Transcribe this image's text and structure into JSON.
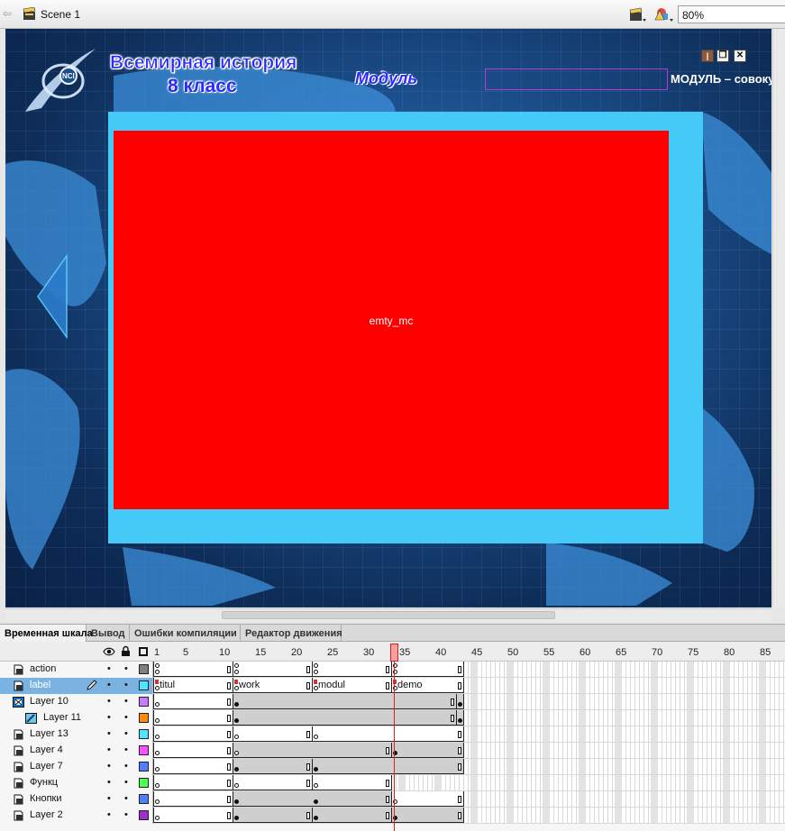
{
  "editbar": {
    "scene_label": "Scene 1",
    "zoom_value": "80%"
  },
  "stage": {
    "title_line1": "Всемирная история",
    "title_line2": "8 класс",
    "module_label": "Модуль",
    "module_right_label": "МОДУЛЬ – совокупность",
    "empty_mc_label": "emty_mc",
    "window_buttons": [
      "pin",
      "restore",
      "close"
    ],
    "colors": {
      "frame": "#45c9f6",
      "content": "#ff0000",
      "title": "#2a2aff"
    }
  },
  "panel_tabs": [
    {
      "label": "Временная шкала",
      "active": true
    },
    {
      "label": "Вывод",
      "active": false
    },
    {
      "label": "Ошибки компиляции",
      "active": false
    },
    {
      "label": "Редактор движения",
      "active": false
    }
  ],
  "timeline": {
    "ruler_ticks": [
      "1",
      "5",
      "10",
      "15",
      "20",
      "25",
      "30",
      "35",
      "40",
      "45",
      "50",
      "55",
      "60",
      "65",
      "70",
      "75",
      "80",
      "85"
    ],
    "current_frame": 34,
    "layers": [
      {
        "name": "action",
        "color": "#808080",
        "type": "normal",
        "selected": false
      },
      {
        "name": "label",
        "color": "#4fe4ff",
        "type": "normal",
        "selected": true,
        "frame_labels": [
          "titul",
          "work",
          "modul",
          "demo"
        ]
      },
      {
        "name": "Layer 10",
        "color": "#c77dff",
        "type": "mask",
        "selected": false
      },
      {
        "name": "Layer 11",
        "color": "#ff8c00",
        "type": "masked",
        "selected": false
      },
      {
        "name": "Layer 13",
        "color": "#4fe4ff",
        "type": "normal",
        "selected": false
      },
      {
        "name": "Layer 4",
        "color": "#ff4fff",
        "type": "normal",
        "selected": false
      },
      {
        "name": "Layer 7",
        "color": "#4f7fff",
        "type": "normal",
        "selected": false
      },
      {
        "name": "Функц",
        "color": "#4fff4f",
        "type": "normal",
        "selected": false
      },
      {
        "name": "Кнопки",
        "color": "#4f7fff",
        "type": "normal",
        "selected": false
      },
      {
        "name": "Layer 2",
        "color": "#9b30d0",
        "type": "normal",
        "selected": false
      }
    ]
  }
}
